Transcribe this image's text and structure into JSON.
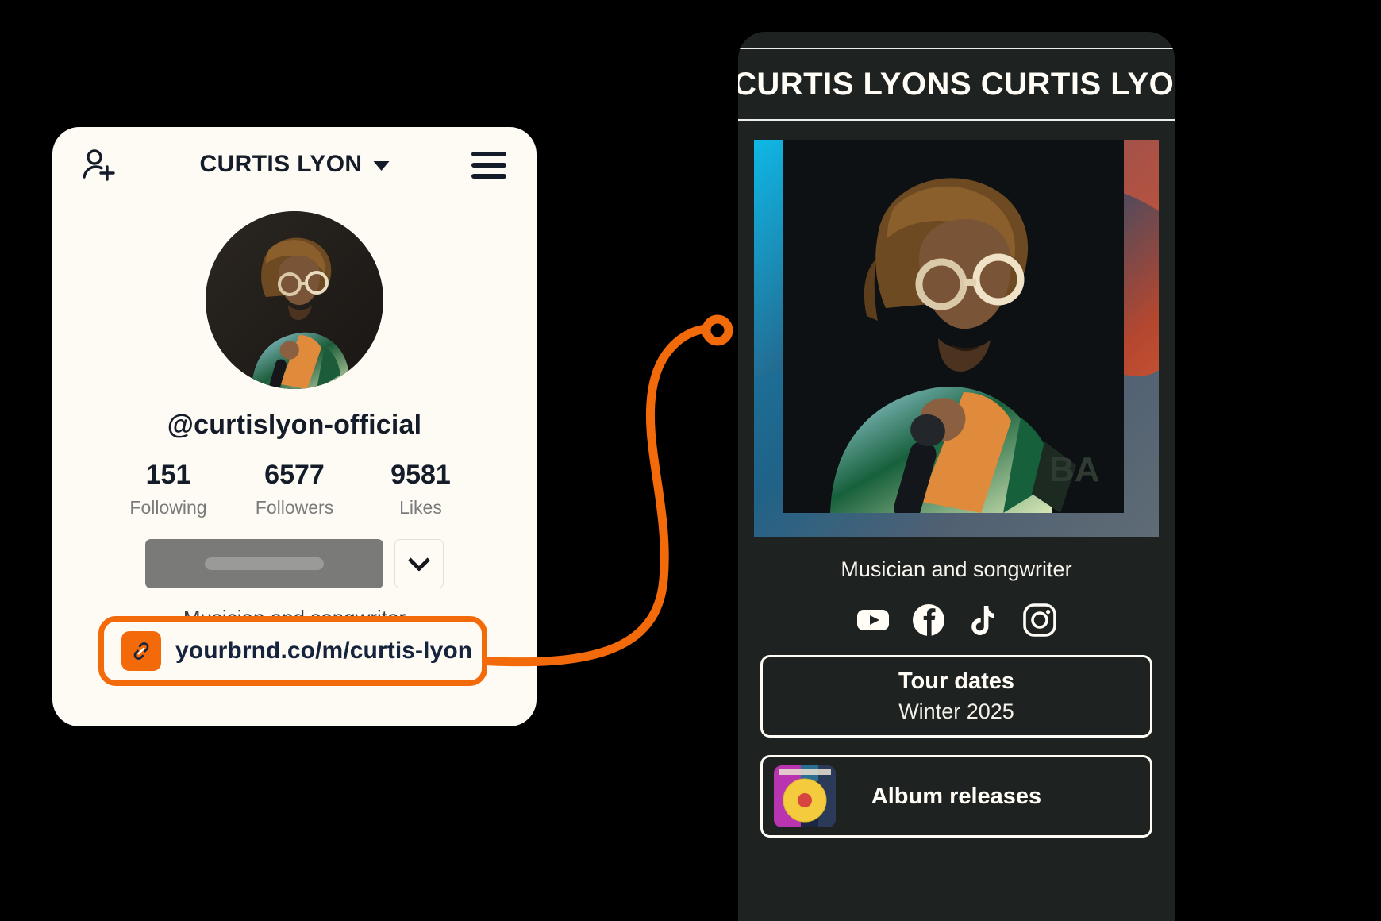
{
  "colors": {
    "accent_orange": "#f26a0a",
    "card_bg": "#fdfbf4",
    "phone_bg": "#1e2322",
    "ink": "#141b29",
    "muted": "#7b7b7b",
    "link_ink": "#16233d"
  },
  "left_card": {
    "add_user_icon": "add-user-icon",
    "menu_icon": "hamburger-menu-icon",
    "title": "CURTIS LYON",
    "title_caret": "chevron-down-icon",
    "avatar_alt": "profile-photo",
    "handle": "@curtislyon-official",
    "stats": [
      {
        "value": "151",
        "label": "Following"
      },
      {
        "value": "6577",
        "label": "Followers"
      },
      {
        "value": "9581",
        "label": "Likes"
      }
    ],
    "follow_button_label": "",
    "follow_more_icon": "chevron-down-icon",
    "bio": "Musician and songwriter",
    "link": {
      "icon": "link-chain-icon",
      "url": "yourbrnd.co/m/curtis-lyon"
    }
  },
  "phone": {
    "marquee_text": "CURTIS LYONS CURTIS LYONS CURTIS LYONS",
    "hero_alt": "artist-performing-photo",
    "bio": "Musician and songwriter",
    "socials": [
      {
        "name": "youtube-icon",
        "label": "YouTube"
      },
      {
        "name": "facebook-icon",
        "label": "Facebook"
      },
      {
        "name": "tiktok-icon",
        "label": "TikTok"
      },
      {
        "name": "instagram-icon",
        "label": "Instagram"
      }
    ],
    "buttons": [
      {
        "title": "Tour dates",
        "subtitle": "Winter 2025",
        "thumb": false
      },
      {
        "title": "Album releases",
        "subtitle": "",
        "thumb": true,
        "thumb_alt": "vinyl-record-album-art"
      }
    ]
  }
}
